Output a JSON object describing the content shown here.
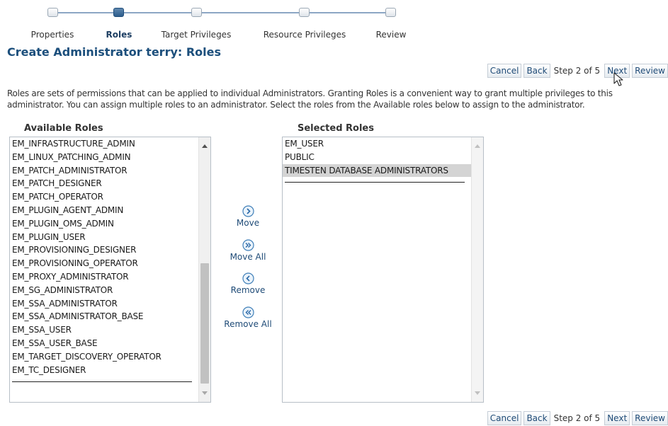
{
  "train": {
    "steps": [
      {
        "label": "Properties",
        "state": "visited"
      },
      {
        "label": "Roles",
        "state": "current"
      },
      {
        "label": "Target Privileges",
        "state": "unvisited"
      },
      {
        "label": "Resource Privileges",
        "state": "unvisited"
      },
      {
        "label": "Review",
        "state": "unvisited"
      }
    ]
  },
  "page": {
    "title": "Create Administrator terry: Roles",
    "description": "Roles are sets of permissions that can be applied to individual Administrators. Granting Roles is a convenient way to grant multiple privileges to this administrator. You can assign multiple roles to an administrator. Select the roles from the Available roles below to assign to the administrator."
  },
  "nav": {
    "cancel_label": "Cancel",
    "back_label": "Back",
    "step_text": "Step 2 of 5",
    "next_label": "Next",
    "review_label": "Review"
  },
  "shuttle": {
    "available_header": "Available Roles",
    "selected_header": "Selected Roles",
    "available_items": [
      "EM_INFRASTRUCTURE_ADMIN",
      "EM_LINUX_PATCHING_ADMIN",
      "EM_PATCH_ADMINISTRATOR",
      "EM_PATCH_DESIGNER",
      "EM_PATCH_OPERATOR",
      "EM_PLUGIN_AGENT_ADMIN",
      "EM_PLUGIN_OMS_ADMIN",
      "EM_PLUGIN_USER",
      "EM_PROVISIONING_DESIGNER",
      "EM_PROVISIONING_OPERATOR",
      "EM_PROXY_ADMINISTRATOR",
      "EM_SG_ADMINISTRATOR",
      "EM_SSA_ADMINISTRATOR",
      "EM_SSA_ADMINISTRATOR_BASE",
      "EM_SSA_USER",
      "EM_SSA_USER_BASE",
      "EM_TARGET_DISCOVERY_OPERATOR",
      "EM_TC_DESIGNER"
    ],
    "selected_items": [
      "EM_USER",
      "PUBLIC",
      "TIMESTEN DATABASE ADMINISTRATORS"
    ],
    "highlighted_selected_index": 2,
    "move_label": "Move",
    "move_all_label": "Move All",
    "remove_label": "Remove",
    "remove_all_label": "Remove All"
  },
  "colors": {
    "title": "#1c4f7c",
    "link_button_text": "#1f4b77",
    "train_current": "#2d5d8c",
    "selection_bg": "#d4d4d4"
  },
  "icons": {
    "move": "chevron-right-circle-icon",
    "move_all": "double-chevron-right-circle-icon",
    "remove": "chevron-left-circle-icon",
    "remove_all": "double-chevron-left-circle-icon",
    "pointer": "mouse-pointer-icon"
  }
}
